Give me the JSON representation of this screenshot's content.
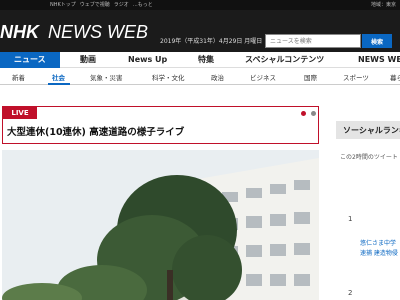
{
  "topbar": {
    "links": [
      "NHKトップ",
      "ウェブで視聴",
      "ラジオ",
      "…もっと"
    ],
    "settings": "地域：東京"
  },
  "header": {
    "logo_nhk": "NHK",
    "logo_news": "NEWS WEB",
    "date": "2019年（平成31年）4月29日 月曜日"
  },
  "search": {
    "placeholder": "ニュースを検索",
    "button_label": "検索"
  },
  "main_nav": [
    "ニュース",
    "動画",
    "News Up",
    "特集",
    "スペシャルコンテンツ",
    "NEWS WEB"
  ],
  "sub_nav": [
    "新着",
    "社会",
    "気象・災害",
    "科学・文化",
    "政治",
    "ビジネス",
    "国際",
    "スポーツ",
    "暮らし"
  ],
  "live": {
    "badge": "LIVE",
    "title": "大型連休(10連休) 高速道路の様子ライブ"
  },
  "sidebar": {
    "heading": "ソーシャルランキング",
    "subtitle": "この2時間のツイート",
    "ranks": [
      {
        "rank": "1",
        "text_line1": "悠仁さま中学",
        "text_line2": "速捕 建造物侵"
      },
      {
        "rank": "2",
        "text_line1": "",
        "text_line2": ""
      }
    ]
  },
  "colors": {
    "header_bg": "#1b1b1b",
    "accent_blue": "#0a67c2",
    "live_red": "#c0102a"
  }
}
